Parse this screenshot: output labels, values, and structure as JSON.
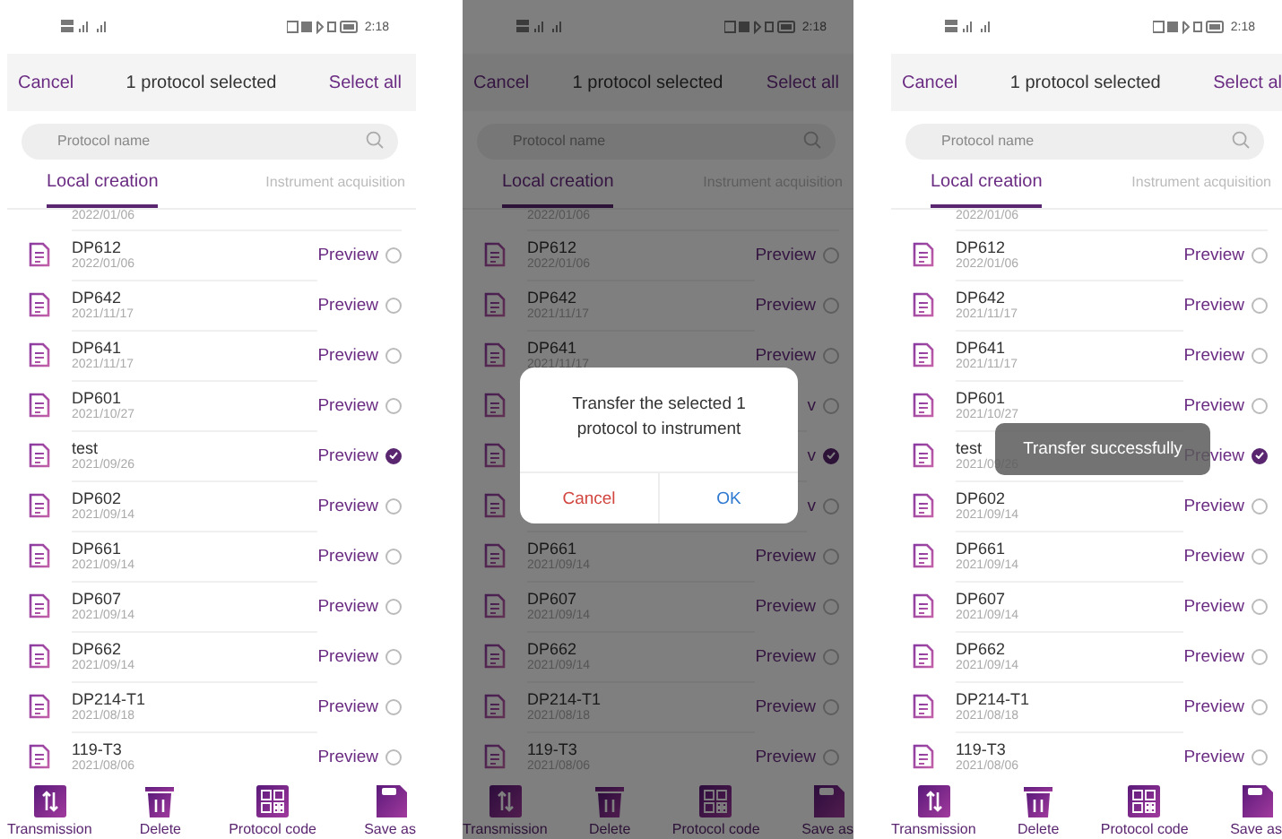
{
  "screens": [
    {
      "status_bar": {
        "time": "2:18"
      },
      "header": {
        "cancel": "Cancel",
        "title": "1 protocol selected",
        "select_all": "Select all"
      },
      "search": {
        "placeholder": "Protocol name"
      },
      "tabs": [
        {
          "label": "Local creation",
          "selected": true
        },
        {
          "label": "Instrument acquisition",
          "selected": false
        }
      ],
      "rows": [
        {
          "kind": "partial",
          "date": "2022/01/06"
        },
        {
          "kind": "item",
          "name": "DP612",
          "date": "2022/01/06",
          "preview": "Preview",
          "selected": false
        },
        {
          "kind": "item",
          "name": "DP642",
          "date": "2021/11/17",
          "preview": "Preview",
          "selected": false
        },
        {
          "kind": "item",
          "name": "DP641",
          "date": "2021/11/17",
          "preview": "Preview",
          "selected": false
        },
        {
          "kind": "item",
          "name": "DP601",
          "date": "2021/10/27",
          "preview": "Preview",
          "selected": false
        },
        {
          "kind": "item",
          "name": "test",
          "date": "2021/09/26",
          "preview": "Preview",
          "selected": true
        },
        {
          "kind": "item",
          "name": "DP602",
          "date": "2021/09/14",
          "preview": "Preview",
          "selected": false
        },
        {
          "kind": "item",
          "name": "DP661",
          "date": "2021/09/14",
          "preview": "Preview",
          "selected": false
        },
        {
          "kind": "item",
          "name": "DP607",
          "date": "2021/09/14",
          "preview": "Preview",
          "selected": false
        },
        {
          "kind": "item",
          "name": "DP662",
          "date": "2021/09/14",
          "preview": "Preview",
          "selected": false
        },
        {
          "kind": "item",
          "name": "DP214-T1",
          "date": "2021/08/18",
          "preview": "Preview",
          "selected": false
        },
        {
          "kind": "item",
          "name": "119-T3",
          "date": "2021/08/06",
          "preview": "Preview",
          "selected": false
        }
      ],
      "toolbar": [
        {
          "kind": "transfer",
          "label": "Transmission"
        },
        {
          "kind": "delete",
          "label": "Delete"
        },
        {
          "kind": "qr",
          "label": "Protocol code"
        },
        {
          "kind": "save",
          "label": "Save as"
        }
      ]
    },
    {
      "status_bar": {
        "time": "2:18"
      },
      "header": {
        "cancel": "Cancel",
        "title": "1 protocol selected",
        "select_all": "Select all"
      },
      "search": {
        "placeholder": "Protocol name"
      },
      "tabs": [
        {
          "label": "Local creation",
          "selected": true
        },
        {
          "label": "Instrument acquisition",
          "selected": false
        }
      ],
      "rows": [
        {
          "kind": "partial",
          "date": "2022/01/06"
        },
        {
          "kind": "item",
          "name": "DP612",
          "date": "2022/01/06",
          "preview": "Preview",
          "selected": false
        },
        {
          "kind": "item",
          "name": "DP642",
          "date": "2021/11/17",
          "preview": "Preview",
          "selected": false
        },
        {
          "kind": "item",
          "name": "DP641",
          "date": "2021/11/17",
          "preview": "Preview",
          "selected": false
        },
        {
          "kind": "covered",
          "preview": "v",
          "selected": false
        },
        {
          "kind": "covered",
          "preview": "v",
          "selected": true
        },
        {
          "kind": "covered",
          "preview": "v",
          "selected": false
        },
        {
          "kind": "item",
          "name": "DP661",
          "date": "2021/09/14",
          "preview": "Preview",
          "selected": false
        },
        {
          "kind": "item",
          "name": "DP607",
          "date": "2021/09/14",
          "preview": "Preview",
          "selected": false
        },
        {
          "kind": "item",
          "name": "DP662",
          "date": "2021/09/14",
          "preview": "Preview",
          "selected": false
        },
        {
          "kind": "item",
          "name": "DP214-T1",
          "date": "2021/08/18",
          "preview": "Preview",
          "selected": false
        },
        {
          "kind": "item",
          "name": "119-T3",
          "date": "2021/08/06",
          "preview": "Preview",
          "selected": false
        }
      ],
      "toolbar": [
        {
          "kind": "transfer",
          "label": "Transmission"
        },
        {
          "kind": "delete",
          "label": "Delete"
        },
        {
          "kind": "qr",
          "label": "Protocol code"
        },
        {
          "kind": "save",
          "label": "Save as"
        }
      ],
      "dialog": {
        "message": "Transfer the selected 1 protocol to instrument",
        "cancel": "Cancel",
        "ok": "OK"
      }
    },
    {
      "status_bar": {
        "time": "2:18"
      },
      "header": {
        "cancel": "Cancel",
        "title": "1 protocol selected",
        "select_all": "Select al"
      },
      "search": {
        "placeholder": "Protocol name"
      },
      "tabs": [
        {
          "label": "Local creation",
          "selected": true
        },
        {
          "label": "Instrument acquisition",
          "selected": false
        }
      ],
      "rows": [
        {
          "kind": "partial",
          "date": "2022/01/06"
        },
        {
          "kind": "item",
          "name": "DP612",
          "date": "2022/01/06",
          "preview": "Preview",
          "selected": false
        },
        {
          "kind": "item",
          "name": "DP642",
          "date": "2021/11/17",
          "preview": "Preview",
          "selected": false
        },
        {
          "kind": "item",
          "name": "DP641",
          "date": "2021/11/17",
          "preview": "Preview",
          "selected": false
        },
        {
          "kind": "item",
          "name": "DP601",
          "date": "2021/10/27",
          "preview": "Preview",
          "selected": false
        },
        {
          "kind": "item",
          "name": "test",
          "date": "2021/09/26",
          "preview": "Preview",
          "selected": true
        },
        {
          "kind": "item",
          "name": "DP602",
          "date": "2021/09/14",
          "preview": "Preview",
          "selected": false
        },
        {
          "kind": "item",
          "name": "DP661",
          "date": "2021/09/14",
          "preview": "Preview",
          "selected": false
        },
        {
          "kind": "item",
          "name": "DP607",
          "date": "2021/09/14",
          "preview": "Preview",
          "selected": false
        },
        {
          "kind": "item",
          "name": "DP662",
          "date": "2021/09/14",
          "preview": "Preview",
          "selected": false
        },
        {
          "kind": "item",
          "name": "DP214-T1",
          "date": "2021/08/18",
          "preview": "Preview",
          "selected": false
        },
        {
          "kind": "item",
          "name": "119-T3",
          "date": "2021/08/06",
          "preview": "Preview",
          "selected": false
        }
      ],
      "toolbar": [
        {
          "kind": "transfer",
          "label": "Transmission"
        },
        {
          "kind": "delete",
          "label": "Delete"
        },
        {
          "kind": "qr",
          "label": "Protocol code"
        },
        {
          "kind": "save",
          "label": "Save as"
        }
      ],
      "toast": {
        "message": "Transfer successfully"
      }
    }
  ]
}
